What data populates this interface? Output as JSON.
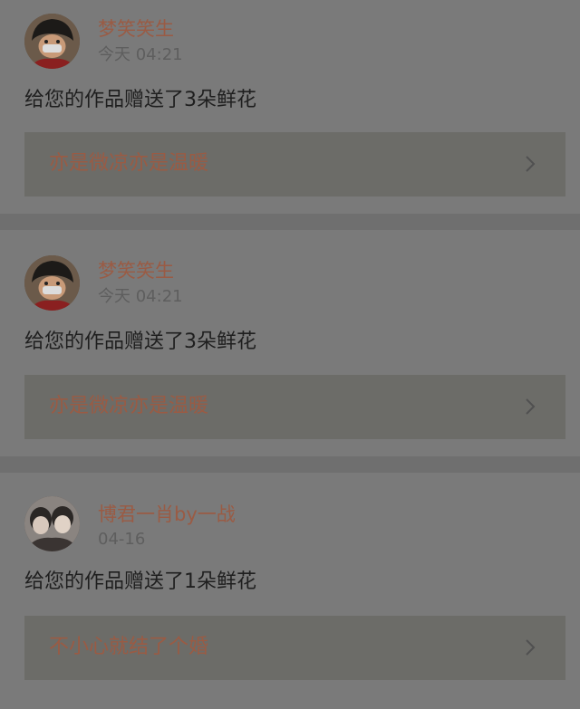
{
  "notifications": [
    {
      "username": "梦笑笑生",
      "time": "今天 04:21",
      "message": "给您的作品赠送了3朵鲜花",
      "work_title": "亦是微凉亦是温暖"
    },
    {
      "username": "梦笑笑生",
      "time": "今天 04:21",
      "message": "给您的作品赠送了3朵鲜花",
      "work_title": "亦是微凉亦是温暖"
    },
    {
      "username": "博君一肖by一战",
      "time": "04-16",
      "message": "给您的作品赠送了1朵鲜花",
      "work_title": "不小心就结了个婚"
    }
  ],
  "icons": {
    "chevron": "chevron-right-icon"
  },
  "colors": {
    "accent": "#9a5b44",
    "card": "#7a7a7a",
    "link_box": "#6c6c68"
  }
}
